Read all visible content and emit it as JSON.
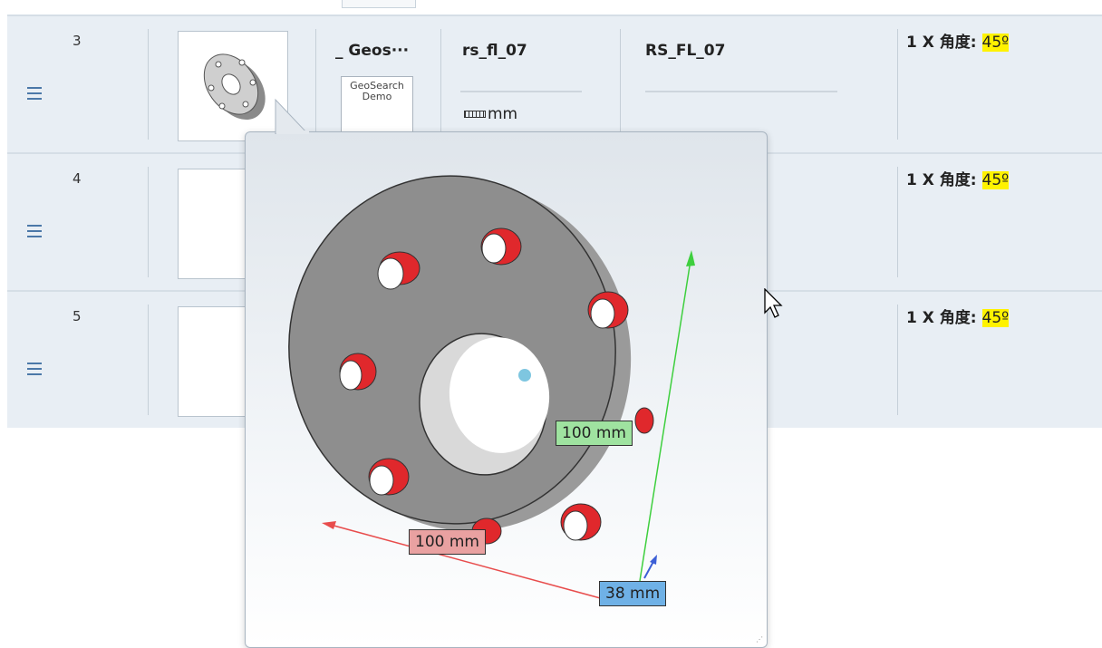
{
  "rows": [
    {
      "number": "3",
      "name": "_ Geos···",
      "id": "rs_fl_07",
      "code": "RS_FL_07",
      "unit": "mm",
      "angle_prefix": "1 X 角度: ",
      "angle_value": "45º"
    },
    {
      "number": "4",
      "angle_prefix": "1 X 角度: ",
      "angle_value": "45º"
    },
    {
      "number": "5",
      "angle_prefix": "1 X 角度: ",
      "angle_value": "45º"
    }
  ],
  "demo_logo": {
    "line1": "GeoSearch",
    "line2": "Demo"
  },
  "preview": {
    "dim_green": "100 mm",
    "dim_red": "100 mm",
    "dim_blue": "38 mm"
  },
  "colors": {
    "row_bg": "#e8eef4",
    "highlight": "#fff200",
    "axis_green": "#3ecf3e",
    "axis_red": "#e84c4c",
    "axis_blue": "#3c5fd6",
    "hole_red": "#e0282c"
  },
  "icons": {
    "drag": "hamburger-icon",
    "ruler": "ruler-icon",
    "cursor": "mouse-pointer-icon"
  }
}
